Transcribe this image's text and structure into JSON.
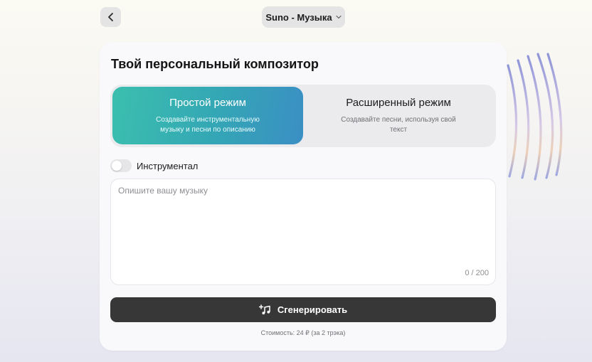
{
  "header": {
    "back_icon": "chevron-left-icon",
    "title": "Suno - Музыка",
    "dropdown_icon": "chevron-down-icon"
  },
  "card": {
    "title": "Твой персональный композитор"
  },
  "modes": [
    {
      "name": "Простой режим",
      "description": "Создавайте инструментальную музыку и песни по описанию",
      "selected": true
    },
    {
      "name": "Расширенный режим",
      "description": "Создавайте песни, используя свой текст",
      "selected": false
    }
  ],
  "instrumental": {
    "label": "Инструментал",
    "enabled": false
  },
  "prompt": {
    "placeholder": "Опишите вашу музыку",
    "value": "",
    "counter": "0 / 200"
  },
  "generate": {
    "icon": "music-sparkle-icon",
    "label": "Сгенерировать"
  },
  "cost": "Стоимость: 24 ₽ (за 2 трэка)",
  "colors": {
    "accent_start": "#3bbfae",
    "accent_end": "#3b8fc4",
    "button_dark": "#373737"
  }
}
